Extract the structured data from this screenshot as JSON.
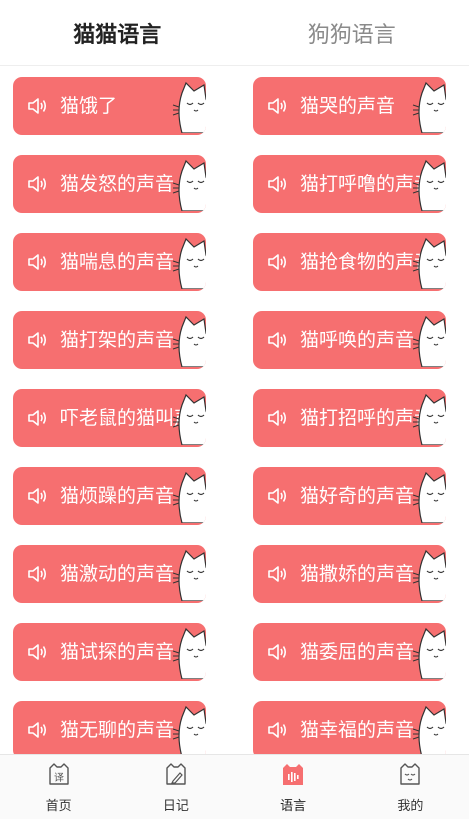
{
  "top_tabs": [
    {
      "label": "猫猫语言",
      "active": true
    },
    {
      "label": "狗狗语言",
      "active": false
    }
  ],
  "sounds": [
    "猫饿了",
    "猫哭的声音",
    "猫发怒的声音",
    "猫打呼噜的声音",
    "猫喘息的声音",
    "猫抢食物的声音",
    "猫打架的声音",
    "猫呼唤的声音",
    "吓老鼠的猫叫声",
    "猫打招呼的声音",
    "猫烦躁的声音",
    "猫好奇的声音",
    "猫激动的声音",
    "猫撒娇的声音",
    "猫试探的声音",
    "猫委屈的声音",
    "猫无聊的声音",
    "猫幸福的声音"
  ],
  "bottom_nav": [
    {
      "label": "首页",
      "icon": "translate-icon",
      "icon_text": "译"
    },
    {
      "label": "日记",
      "icon": "diary-icon"
    },
    {
      "label": "语言",
      "icon": "sound-wave-icon",
      "active": true
    },
    {
      "label": "我的",
      "icon": "cat-face-icon"
    }
  ],
  "colors": {
    "card": "#f66f70",
    "active_nav": "#f66f70",
    "text_dark": "#222222",
    "text_muted": "#8a8a8a"
  }
}
